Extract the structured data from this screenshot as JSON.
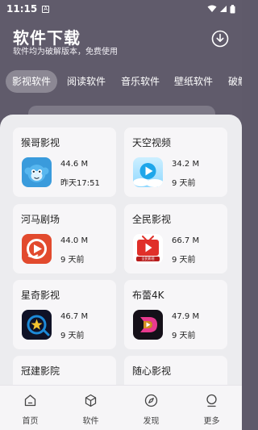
{
  "status_bar": {
    "time": "11:15",
    "notification": "A"
  },
  "header": {
    "title": "软件下载",
    "subtitle": "软件均为破解版本，免费使用"
  },
  "tabs": [
    {
      "label": "影视软件",
      "active": true
    },
    {
      "label": "阅读软件",
      "active": false
    },
    {
      "label": "音乐软件",
      "active": false
    },
    {
      "label": "壁纸软件",
      "active": false
    },
    {
      "label": "破解",
      "active": false
    }
  ],
  "apps": [
    {
      "name": "猴哥影视",
      "size": "44.6 M",
      "date": "昨天17:51",
      "icon": "monkey-icon"
    },
    {
      "name": "天空视频",
      "size": "34.2 M",
      "date": "9 天前",
      "icon": "sky-play-icon"
    },
    {
      "name": "河马剧场",
      "size": "44.0 M",
      "date": "9 天前",
      "icon": "hippo-icon"
    },
    {
      "name": "全民影视",
      "size": "66.7 M",
      "date": "9 天前",
      "icon": "tv-icon"
    },
    {
      "name": "星奇影视",
      "size": "46.7 M",
      "date": "9 天前",
      "icon": "star-play-icon"
    },
    {
      "name": "布蕾4K",
      "size": "47.9 M",
      "date": "9 天前",
      "icon": "d-logo-icon"
    },
    {
      "name": "冠建影院",
      "size": "",
      "date": "",
      "icon": ""
    },
    {
      "name": "随心影视",
      "size": "",
      "date": "",
      "icon": ""
    }
  ],
  "tv_icon_text": "全民影视",
  "bottom_nav": [
    {
      "label": "首页",
      "icon": "home-icon"
    },
    {
      "label": "软件",
      "icon": "cube-icon"
    },
    {
      "label": "发现",
      "icon": "compass-icon"
    },
    {
      "label": "更多",
      "icon": "more-icon"
    }
  ],
  "colors": {
    "header_bg": "#605b6b",
    "sheet_bg": "#ececef",
    "card_bg": "#f7f6f8"
  }
}
